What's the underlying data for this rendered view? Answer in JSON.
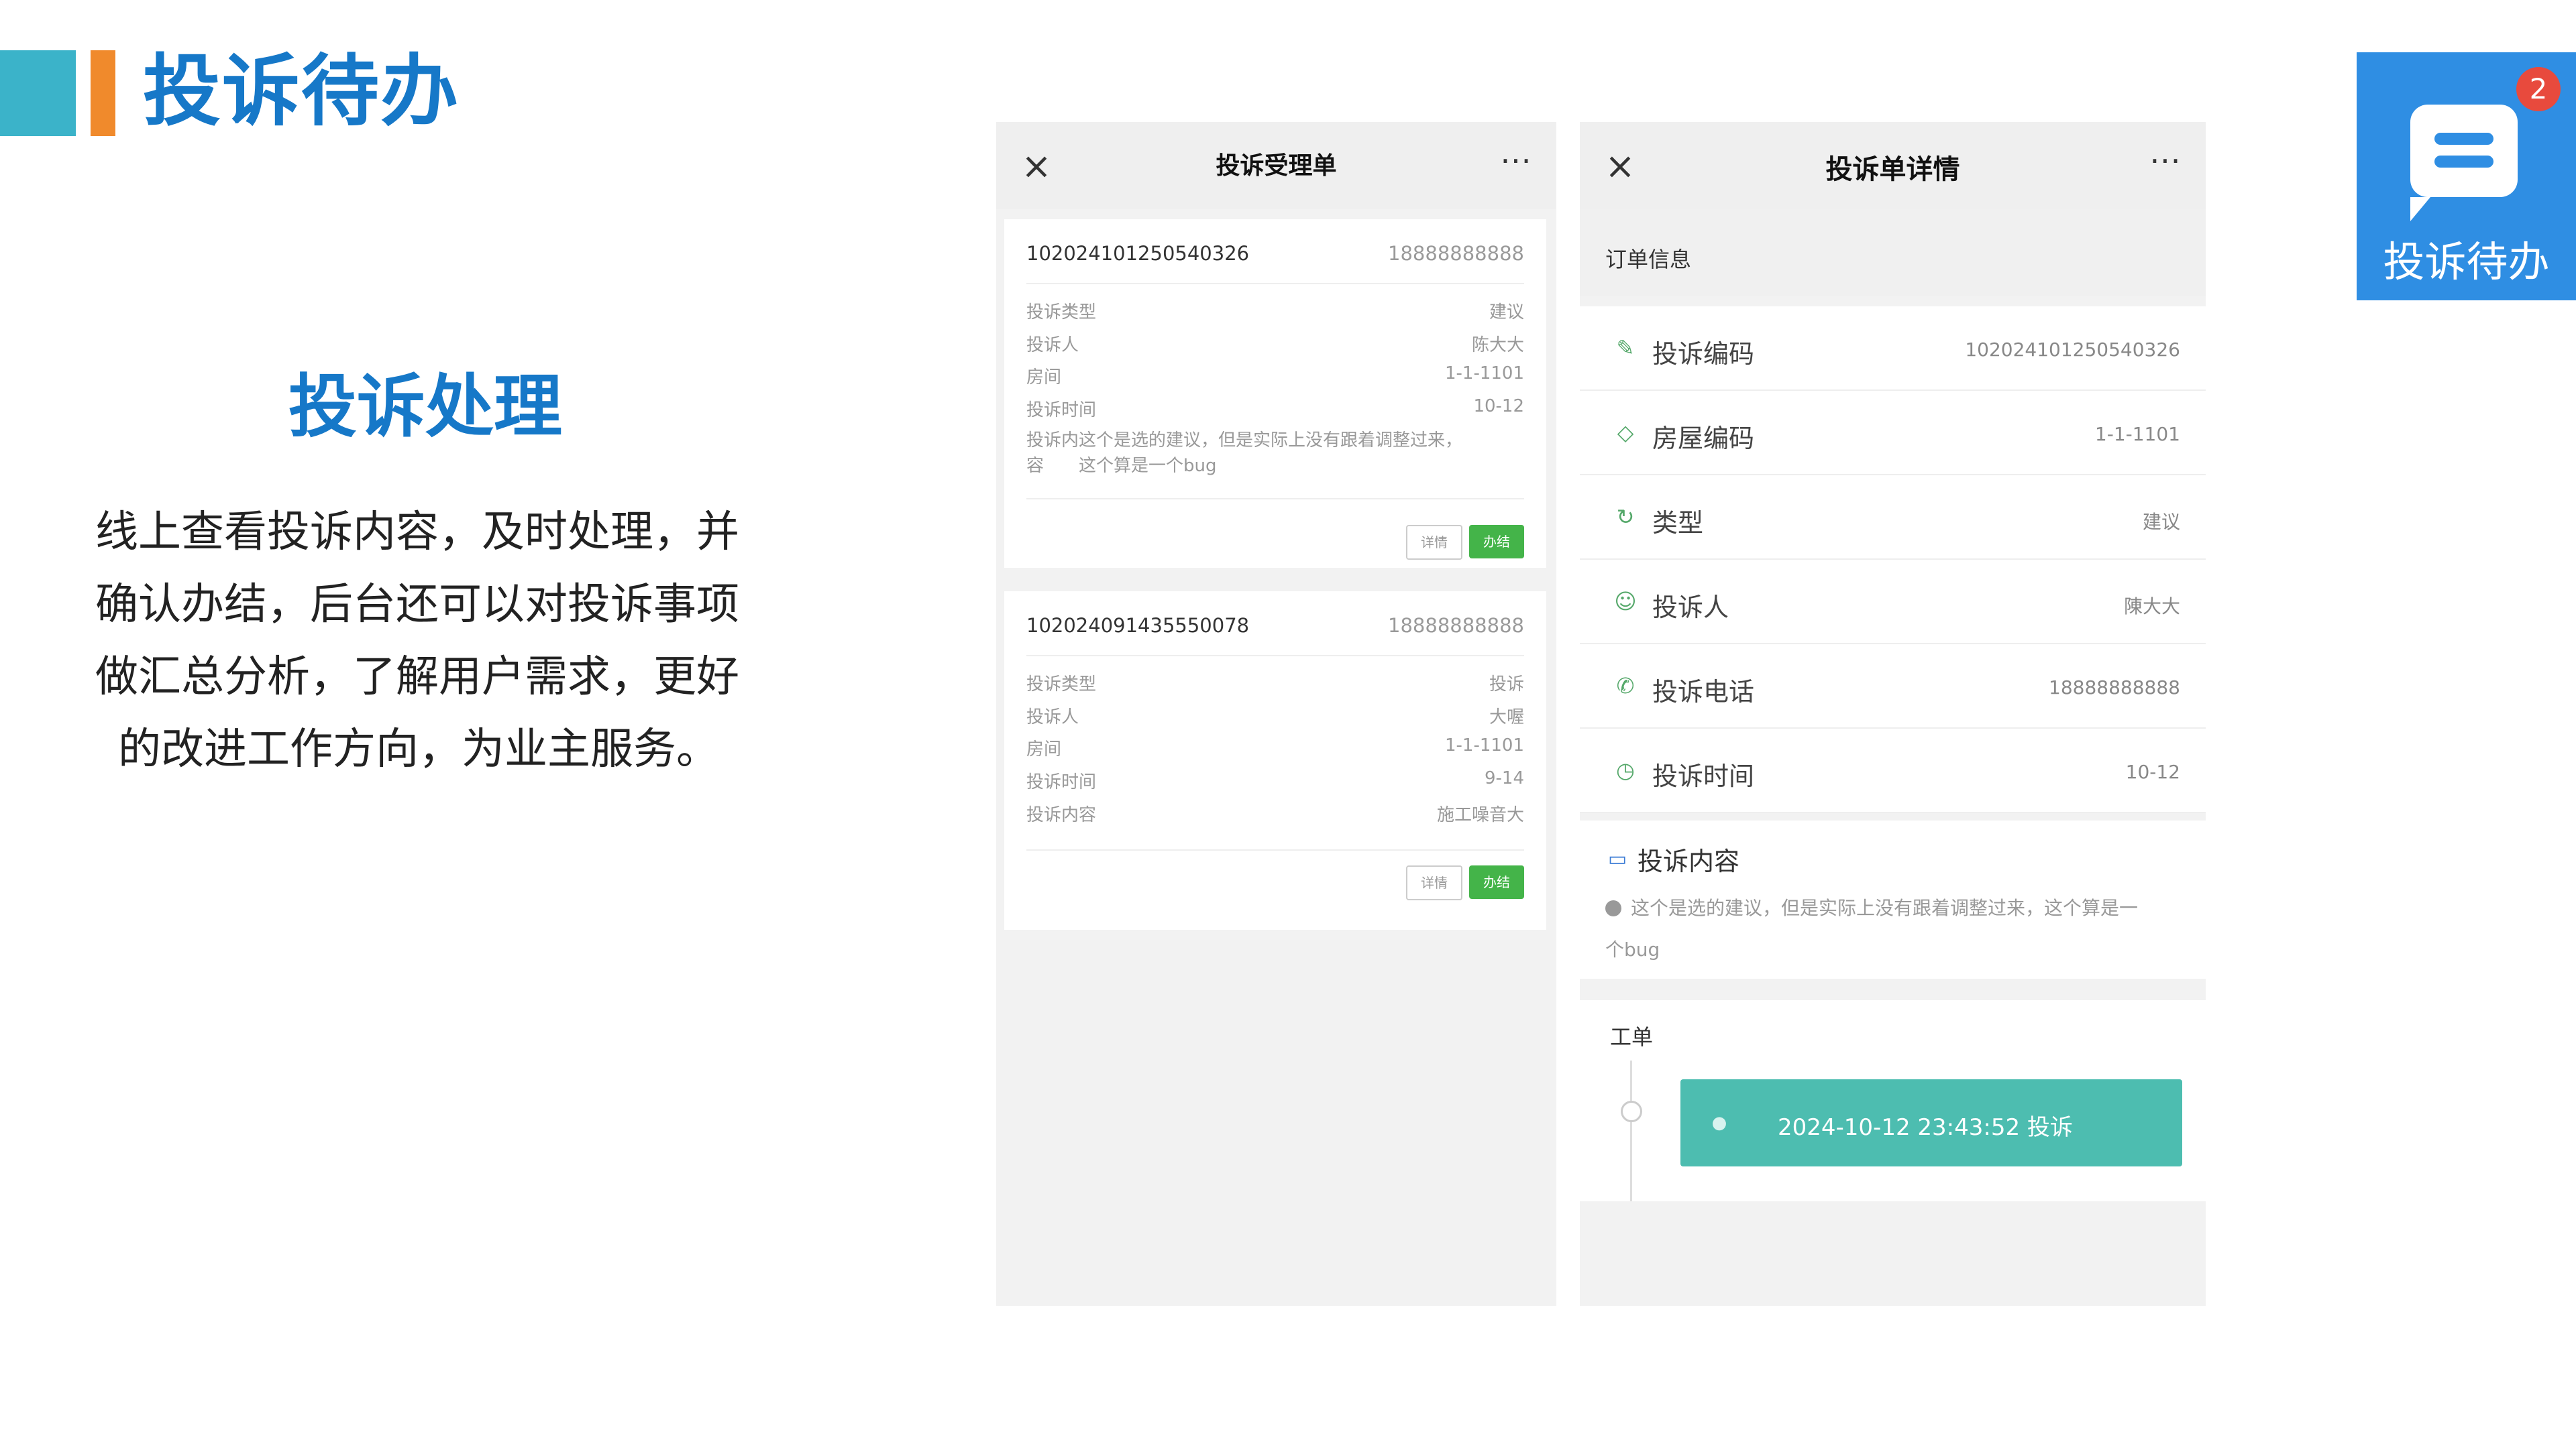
{
  "header": {
    "title": "投诉待办"
  },
  "section": {
    "title": "投诉处理",
    "desc_lines": [
      "线上查看投诉内容，及时处理，并",
      "确认办结，后台还可以对投诉事项",
      "做汇总分析，了解用户需求，更好",
      "的改进工作方向，为业主服务。"
    ]
  },
  "phone1": {
    "close_icon": "×",
    "more_icon": "···",
    "title": "投诉受理单",
    "cards": [
      {
        "code": "102024101250540326",
        "phone": "18888888888",
        "rows": [
          {
            "k": "投诉类型",
            "v": "建议"
          },
          {
            "k": "投诉人",
            "v": "陈大大"
          },
          {
            "k": "房间",
            "v": "1-1-1101"
          },
          {
            "k": "投诉时间",
            "v": "10-12"
          }
        ],
        "content_line1": "投诉内这个是选的建议，但是实际上没有跟着调整过来，",
        "content_line2": "容　　这个算是一个bug",
        "detail_label": "详情",
        "done_label": "办结"
      },
      {
        "code": "102024091435550078",
        "phone": "18888888888",
        "rows": [
          {
            "k": "投诉类型",
            "v": "投诉"
          },
          {
            "k": "投诉人",
            "v": "大喔"
          },
          {
            "k": "房间",
            "v": "1-1-1101"
          },
          {
            "k": "投诉时间",
            "v": "9-14"
          },
          {
            "k": "投诉内容",
            "v": "施工噪音大"
          }
        ],
        "detail_label": "详情",
        "done_label": "办结"
      }
    ]
  },
  "phone2": {
    "close_icon": "×",
    "more_icon": "···",
    "title": "投诉单详情",
    "section_label": "订单信息",
    "rows": [
      {
        "icon": "✎",
        "label": "投诉编码",
        "value": "102024101250540326"
      },
      {
        "icon": "◇",
        "label": "房屋编码",
        "value": "1-1-1101"
      },
      {
        "icon": "↻",
        "label": "类型",
        "value": "建议"
      },
      {
        "icon": "☺",
        "label": "投诉人",
        "value": "陳大大"
      },
      {
        "icon": "✆",
        "label": "投诉电话",
        "value": "18888888888"
      },
      {
        "icon": "◷",
        "label": "投诉时间",
        "value": "10-12"
      }
    ],
    "content": {
      "icon": "▭",
      "label": "投诉内容",
      "text": "这个是选的建议，但是实际上没有跟着调整过来，这个算是一个bug"
    },
    "work": {
      "label": "工单",
      "event": "2024-10-12 23:43:52 投诉"
    }
  },
  "appicon": {
    "badge": "2",
    "label": "投诉待办"
  },
  "colors": {
    "accent_blue": "#1678c8",
    "teal_bar": "#3bb3c9",
    "orange_bar": "#f08a2c",
    "done_green": "#44b449",
    "event_teal": "#4dbdb0",
    "app_blue": "#2f8ee3",
    "badge_red": "#e84a3d"
  }
}
